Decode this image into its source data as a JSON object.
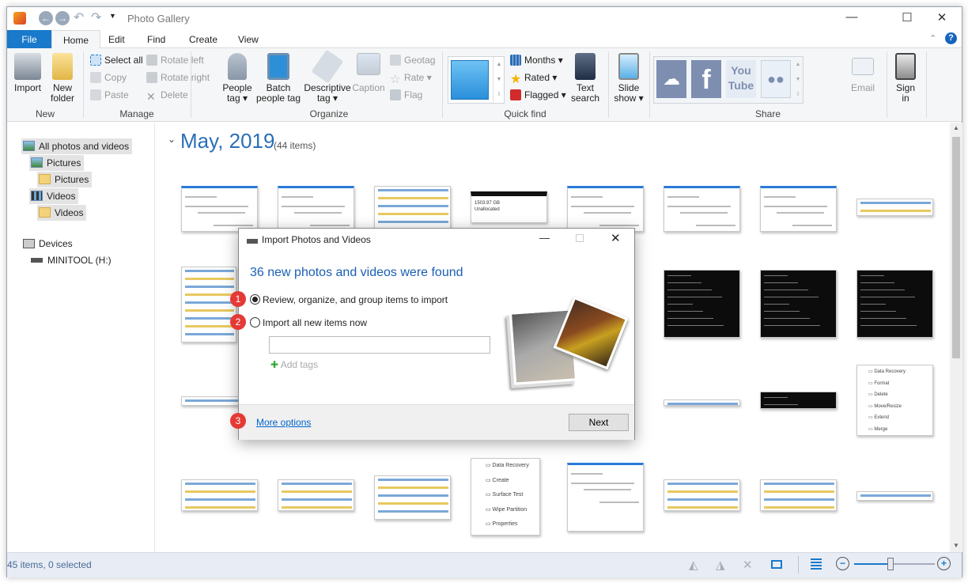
{
  "app": {
    "title": "Photo Gallery"
  },
  "tabs": [
    "File",
    "Home",
    "Edit",
    "Find",
    "Create",
    "View"
  ],
  "ribbon": {
    "new": {
      "label": "New",
      "import": "Import",
      "new_folder": [
        "New",
        "folder"
      ]
    },
    "manage": {
      "label": "Manage",
      "select_all": "Select all",
      "copy": "Copy",
      "paste": "Paste",
      "rotate_left": "Rotate left",
      "rotate_right": "Rotate right",
      "delete": "Delete"
    },
    "organize": {
      "label": "Organize",
      "people_tag": [
        "People",
        "tag"
      ],
      "batch_people_tag": [
        "Batch",
        "people tag"
      ],
      "descriptive_tag": [
        "Descriptive",
        "tag"
      ],
      "caption": "Caption",
      "geotag": "Geotag",
      "rate": "Rate",
      "flag": "Flag"
    },
    "quick_find": {
      "label": "Quick find",
      "months": "Months",
      "rated": "Rated",
      "flagged": "Flagged",
      "text_search": [
        "Text",
        "search"
      ]
    },
    "slideshow": [
      "Slide",
      "show"
    ],
    "share": {
      "label": "Share",
      "email": "Email",
      "services": [
        "OneDrive",
        "Facebook",
        "YouTube",
        "Flickr"
      ],
      "youtube_text": [
        "You",
        "Tube"
      ]
    },
    "sign_in": [
      "Sign",
      "in"
    ]
  },
  "sidebar": {
    "items": [
      {
        "label": "All photos and videos",
        "level": 0
      },
      {
        "label": "Pictures",
        "level": 1
      },
      {
        "label": "Pictures",
        "level": 2
      },
      {
        "label": "Videos",
        "level": 1
      },
      {
        "label": "Videos",
        "level": 2
      }
    ],
    "devices": "Devices",
    "drive": "MINITOOL (H:)"
  },
  "main": {
    "group_title": "May, 2019",
    "group_count": "(44 items)"
  },
  "thumbnails": {
    "unallocated": [
      "1503.97 GB",
      "Unallocated"
    ],
    "menu_a": [
      "Data Recovery",
      "Format",
      "Delete",
      "Move/Resize",
      "Extend",
      "Merge"
    ],
    "menu_b": [
      "Data Recovery",
      "Create",
      "Surface Test",
      "Wipe Partition",
      "Properties"
    ]
  },
  "dialog": {
    "title": "Import Photos and Videos",
    "heading": "36 new photos and videos were found",
    "option1": "Review, organize, and group items to import",
    "option2": "Import all new items now",
    "selected": "option1",
    "tags_value": "",
    "add_tags": "Add tags",
    "more_options": "More options",
    "next": "Next",
    "badges": [
      "1",
      "2",
      "3"
    ]
  },
  "status": {
    "text": "45 items, 0 selected",
    "zoom_fraction": 0.45
  },
  "colors": {
    "accent": "#1979ca",
    "heading": "#1a5fb4",
    "link": "#0066cc",
    "badge": "#e53935"
  }
}
